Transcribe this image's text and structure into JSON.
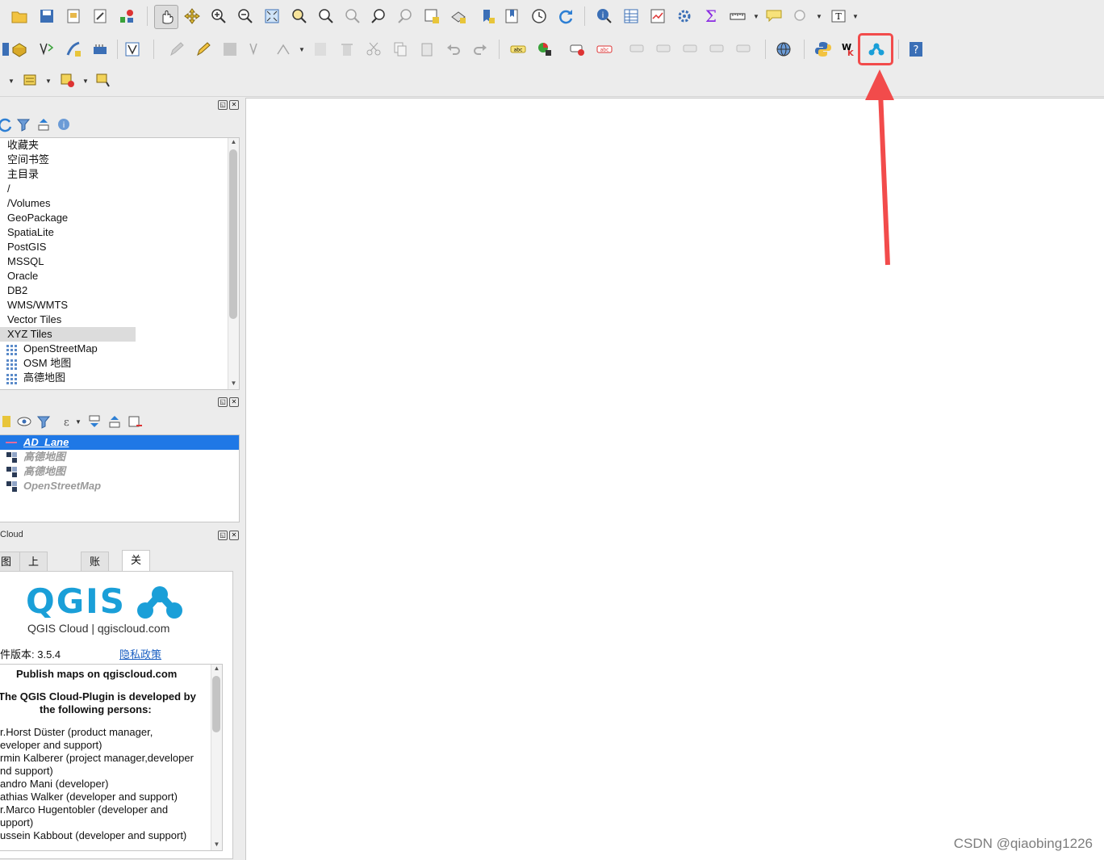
{
  "browser_panel": {
    "items": [
      {
        "label": "收藏夹"
      },
      {
        "label": "空间书签"
      },
      {
        "label": "主目录"
      },
      {
        "label": "/"
      },
      {
        "label": "/Volumes"
      },
      {
        "label": "GeoPackage"
      },
      {
        "label": "SpatiaLite"
      },
      {
        "label": "PostGIS"
      },
      {
        "label": "MSSQL"
      },
      {
        "label": "Oracle"
      },
      {
        "label": "DB2"
      },
      {
        "label": "WMS/WMTS"
      },
      {
        "label": "Vector Tiles"
      },
      {
        "label": "XYZ Tiles"
      }
    ],
    "xyz_children": [
      {
        "label": "OpenStreetMap"
      },
      {
        "label": "OSM 地图"
      },
      {
        "label": "高德地图"
      }
    ]
  },
  "layers_panel": {
    "layers": [
      {
        "label": "AD_Lane",
        "selected": true
      },
      {
        "label": "高德地图"
      },
      {
        "label": "高德地图"
      },
      {
        "label": "OpenStreetMap"
      }
    ]
  },
  "cloud_panel": {
    "title": "Cloud",
    "tabs": [
      "图",
      "上传数据",
      "账户",
      "关于"
    ],
    "active_tab": "关于",
    "logo_text": "QGIS",
    "logo_sub": "QGIS Cloud | qgiscloud.com",
    "version_label": "件版本: 3.5.4",
    "privacy_link": "隐私政策",
    "credits": {
      "heading": "Publish maps on qgiscloud.com",
      "intro_1": "The QGIS Cloud-Plugin is developed by",
      "intro_2": "the following persons:",
      "lines": [
        "r.Horst Düster (product manager,",
        "eveloper and support)",
        "rmin Kalberer (project manager,developer",
        "nd support)",
        "andro Mani (developer)",
        "athias Walker (developer and support)",
        "r.Marco Hugentobler (developer and",
        "upport)",
        "ussein Kabbout (developer and support)"
      ]
    }
  },
  "colors": {
    "highlight": "#f24b4b",
    "selection": "#1f78e6",
    "logo_blue": "#1a9fd8"
  },
  "watermark": "CSDN @qiaobing1226"
}
